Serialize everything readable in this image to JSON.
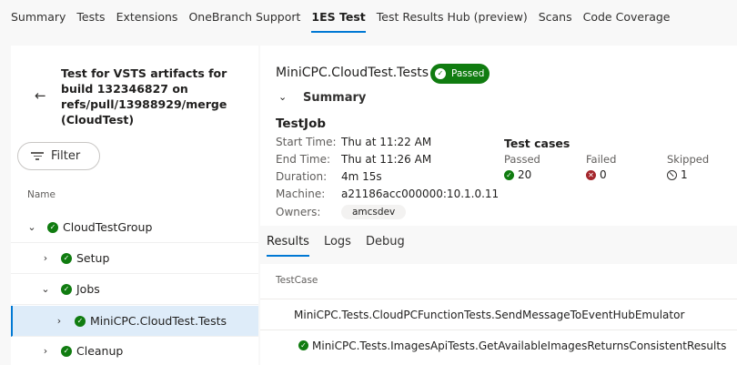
{
  "tabs": [
    {
      "label": "Summary",
      "active": false
    },
    {
      "label": "Tests",
      "active": false
    },
    {
      "label": "Extensions",
      "active": false
    },
    {
      "label": "OneBranch Support",
      "active": false
    },
    {
      "label": "1ES Test",
      "active": true
    },
    {
      "label": "Test Results Hub (preview)",
      "active": false
    },
    {
      "label": "Scans",
      "active": false
    },
    {
      "label": "Code Coverage",
      "active": false
    }
  ],
  "left": {
    "run_title": "Test for VSTS artifacts for build 132346827 on refs/pull/13988929/merge (CloudTest)",
    "filter_label": "Filter",
    "name_header": "Name",
    "tree": [
      {
        "label": "CloudTestGroup",
        "expanded": true,
        "indent": 0
      },
      {
        "label": "Setup",
        "expanded": false,
        "indent": 1
      },
      {
        "label": "Jobs",
        "expanded": true,
        "indent": 1
      },
      {
        "label": "MiniCPC.CloudTest.Tests",
        "expanded": false,
        "indent": 2,
        "selected": true
      },
      {
        "label": "Cleanup",
        "expanded": false,
        "indent": 1
      }
    ]
  },
  "summary": {
    "test_name": "MiniCPC.CloudTest.Tests",
    "status": "Passed",
    "section_title": "Summary",
    "job_title": "TestJob",
    "fields": [
      {
        "key": "Start Time:",
        "value": "Thu at 11:22 AM"
      },
      {
        "key": "End Time:",
        "value": "Thu at 11:26 AM"
      },
      {
        "key": "Duration:",
        "value": "4m 15s"
      },
      {
        "key": "Machine:",
        "value": "a21186acc000000:10.1.0.11"
      },
      {
        "key": "Owners:",
        "value": "amcsdev"
      }
    ],
    "cases_title": "Test cases",
    "passed_label": "Passed",
    "passed_count": "20",
    "failed_label": "Failed",
    "failed_count": "0",
    "skipped_label": "Skipped",
    "skipped_count": "1"
  },
  "sub_tabs": [
    {
      "label": "Results",
      "active": true
    },
    {
      "label": "Logs",
      "active": false
    },
    {
      "label": "Debug",
      "active": false
    }
  ],
  "results": {
    "column": "TestCase",
    "rows": [
      {
        "label": "MiniCPC.Tests.CloudPCFunctionTests.SendMessageToEventHubEmulator",
        "passed": false
      },
      {
        "label": "MiniCPC.Tests.ImagesApiTests.GetAvailableImagesReturnsConsistentResults",
        "passed": true
      }
    ]
  },
  "colors": {
    "accent": "#0078d4",
    "success": "#107c10",
    "failure": "#a4262c"
  }
}
